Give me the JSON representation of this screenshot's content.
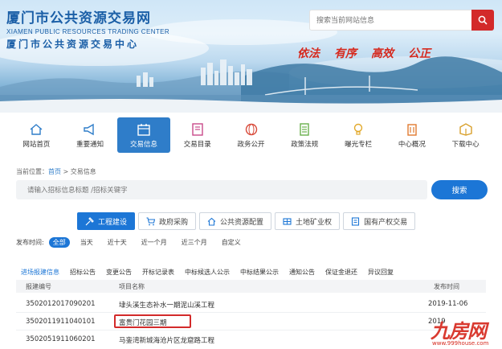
{
  "site": {
    "title_cn": "厦门市公共资源交易网",
    "title_en": "XIAMEN PUBLIC RESOURCES TRADING CENTER",
    "subtitle_cn": "厦门市公共资源交易中心",
    "search_placeholder": "搜索当前网站信息",
    "slogans": [
      "依法",
      "有序",
      "高效",
      "公正"
    ]
  },
  "nav": {
    "items": [
      {
        "label": "网站首页",
        "icon": "home-icon"
      },
      {
        "label": "重要通知",
        "icon": "megaphone-icon"
      },
      {
        "label": "交易信息",
        "icon": "calendar-icon",
        "active": true
      },
      {
        "label": "交易目录",
        "icon": "catalog-icon"
      },
      {
        "label": "政务公开",
        "icon": "globe-icon"
      },
      {
        "label": "政策法规",
        "icon": "document-icon"
      },
      {
        "label": "曝光专栏",
        "icon": "bulb-icon"
      },
      {
        "label": "中心概况",
        "icon": "building-icon"
      },
      {
        "label": "下载中心",
        "icon": "download-box-icon"
      }
    ]
  },
  "breadcrumb": {
    "prefix": "当前位置：",
    "home": "首页",
    "sep": " > ",
    "current": "交易信息"
  },
  "main_search": {
    "placeholder": "请输入招标信息标题 /招标关键字",
    "button": "搜索"
  },
  "categories": [
    {
      "label": "工程建设",
      "active": true
    },
    {
      "label": "政府采购"
    },
    {
      "label": "公共资源配置"
    },
    {
      "label": "土地矿业权"
    },
    {
      "label": "国有产权交易"
    }
  ],
  "time_filter": {
    "label": "发布时间:",
    "options": [
      "全部",
      "当天",
      "近十天",
      "近一个月",
      "近三个月",
      "自定义"
    ],
    "selected": "全部"
  },
  "sub_tabs": [
    "进场报建信息",
    "招标公告",
    "变更公告",
    "开标记录表",
    "中标候选人公示",
    "中标结果公示",
    "通知公告",
    "保证金退还",
    "异议回复"
  ],
  "table": {
    "headers": {
      "code": "报建编号",
      "name": "项目名称",
      "date": "发布时间"
    },
    "rows": [
      {
        "code": "3502012017090201",
        "name": "埭头溪生态补水一期泥山溪工程",
        "date": "2019-11-06"
      },
      {
        "code": "3502011911040101",
        "name": "富贵门花园三期",
        "date": "2019"
      },
      {
        "code": "3502051911060201",
        "name": "马銮湾新城海沧片区龙窟路工程",
        "date": ""
      }
    ]
  },
  "watermark": {
    "big": "九房网",
    "small": "www.999house.com"
  }
}
